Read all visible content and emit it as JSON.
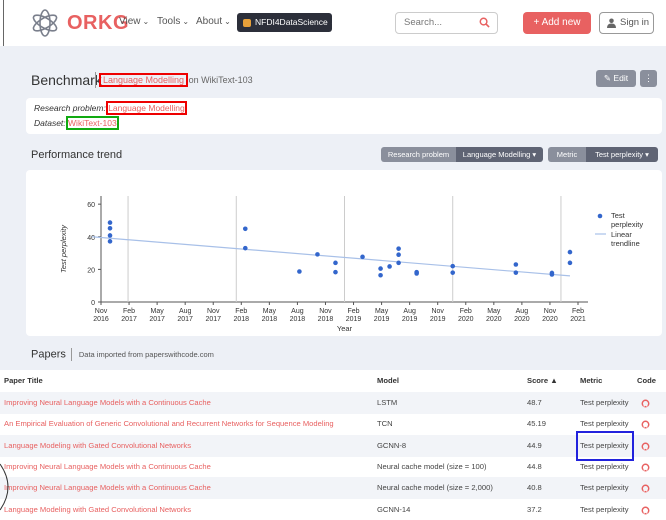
{
  "header": {
    "logo_text": "ORKG",
    "nav": [
      {
        "label": "View"
      },
      {
        "label": "Tools"
      },
      {
        "label": "About"
      }
    ],
    "nfdi_label": "NFDI4DataScience",
    "search_placeholder": "Search...",
    "add_new_label": "+ Add new",
    "sign_in_label": "Sign in"
  },
  "benchmark": {
    "title": "Benchmark",
    "problem_link": "Language Modelling",
    "on_text": "on WikiText-103",
    "edit_label": "Edit",
    "more_label": "⋮"
  },
  "info": {
    "problem_label": "Research problem:",
    "problem_value": "Language Modelling",
    "dataset_label": "Dataset:",
    "dataset_value": "WikiText-103"
  },
  "performance": {
    "title": "Performance trend",
    "filter_problem_label": "Research problem",
    "filter_problem_value": "Language Modelling",
    "filter_metric_label": "Metric",
    "filter_metric_value": "Test perplexity"
  },
  "chart_data": {
    "type": "scatter",
    "xlabel": "Year",
    "ylabel": "Test perplexity",
    "ylim": [
      0,
      65
    ],
    "yticks": [
      0,
      20,
      40,
      60
    ],
    "xticks": [
      {
        "top": "Nov",
        "bottom": "2016"
      },
      {
        "top": "Feb",
        "bottom": "2017"
      },
      {
        "top": "May",
        "bottom": "2017"
      },
      {
        "top": "Aug",
        "bottom": "2017"
      },
      {
        "top": "Nov",
        "bottom": "2017"
      },
      {
        "top": "Feb",
        "bottom": "2018"
      },
      {
        "top": "May",
        "bottom": "2018"
      },
      {
        "top": "Aug",
        "bottom": "2018"
      },
      {
        "top": "Nov",
        "bottom": "2018"
      },
      {
        "top": "Feb",
        "bottom": "2019"
      },
      {
        "top": "May",
        "bottom": "2019"
      },
      {
        "top": "Aug",
        "bottom": "2019"
      },
      {
        "top": "Nov",
        "bottom": "2019"
      },
      {
        "top": "Feb",
        "bottom": "2020"
      },
      {
        "top": "May",
        "bottom": "2020"
      },
      {
        "top": "Aug",
        "bottom": "2020"
      },
      {
        "top": "Nov",
        "bottom": "2020"
      },
      {
        "top": "Feb",
        "bottom": "2021"
      }
    ],
    "grid_lines": [
      "2017",
      "2018",
      "2019",
      "2020",
      "2021"
    ],
    "series": [
      {
        "name": "Test perplexity",
        "color": "#3366cc",
        "points": [
          {
            "x": "2016-12",
            "y": 48.7
          },
          {
            "x": "2016-12",
            "y": 45.2
          },
          {
            "x": "2016-12",
            "y": 40.8
          },
          {
            "x": "2016-12",
            "y": 37.2
          },
          {
            "x": "2018-03",
            "y": 44.9
          },
          {
            "x": "2018-03",
            "y": 33.0
          },
          {
            "x": "2018-09",
            "y": 18.7
          },
          {
            "x": "2018-11",
            "y": 29.2
          },
          {
            "x": "2019-01",
            "y": 24.0
          },
          {
            "x": "2019-01",
            "y": 18.3
          },
          {
            "x": "2019-04",
            "y": 27.7
          },
          {
            "x": "2019-06",
            "y": 20.5
          },
          {
            "x": "2019-06",
            "y": 16.4
          },
          {
            "x": "2019-07",
            "y": 21.8
          },
          {
            "x": "2019-08",
            "y": 32.7
          },
          {
            "x": "2019-08",
            "y": 29.0
          },
          {
            "x": "2019-08",
            "y": 24.0
          },
          {
            "x": "2019-10",
            "y": 18.3
          },
          {
            "x": "2019-10",
            "y": 17.5
          },
          {
            "x": "2020-02",
            "y": 22.0
          },
          {
            "x": "2020-02",
            "y": 18.0
          },
          {
            "x": "2020-09",
            "y": 23.0
          },
          {
            "x": "2020-09",
            "y": 18.0
          },
          {
            "x": "2021-01",
            "y": 17.8
          },
          {
            "x": "2021-01",
            "y": 16.9
          },
          {
            "x": "2021-03",
            "y": 30.6
          },
          {
            "x": "2021-03",
            "y": 24.0
          }
        ]
      },
      {
        "name": "Linear trendline",
        "color": "#a8c0e8",
        "type": "line",
        "points": [
          {
            "x": "2016-10",
            "y": 40.0
          },
          {
            "x": "2021-03",
            "y": 16.0
          }
        ]
      }
    ],
    "legend": "right"
  },
  "papers": {
    "title": "Papers",
    "subtitle": "Data imported from paperswithcode.com",
    "columns": [
      "Paper Title",
      "Model",
      "Score ▲",
      "Metric",
      "Code"
    ],
    "rows": [
      {
        "title": "Improving Neural Language Models with a Continuous Cache",
        "model": "LSTM",
        "score": "48.7",
        "metric": "Test perplexity"
      },
      {
        "title": "An Empirical Evaluation of Generic Convolutional and Recurrent Networks for Sequence Modeling",
        "model": "TCN",
        "score": "45.19",
        "metric": "Test perplexity"
      },
      {
        "title": "Language Modeling with Gated Convolutional Networks",
        "model": "GCNN-8",
        "score": "44.9",
        "metric": "Test perplexity"
      },
      {
        "title": "Improving Neural Language Models with a Continuous Cache",
        "model": "Neural cache model (size = 100)",
        "score": "44.8",
        "metric": "Test perplexity"
      },
      {
        "title": "Improving Neural Language Models with a Continuous Cache",
        "model": "Neural cache model (size = 2,000)",
        "score": "40.8",
        "metric": "Test perplexity"
      },
      {
        "title": "Language Modeling with Gated Convolutional Networks",
        "model": "GCNN-14",
        "score": "37.2",
        "metric": "Test perplexity"
      }
    ]
  },
  "colors": {
    "accent": "#e86161",
    "dark": "#5f6474",
    "page_bg": "#edf0f6"
  }
}
